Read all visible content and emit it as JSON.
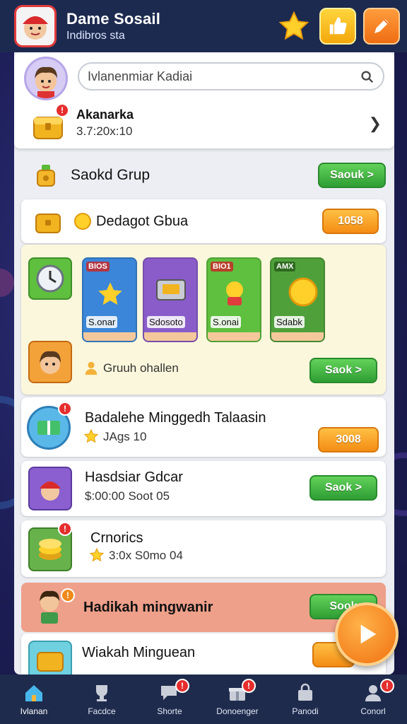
{
  "header": {
    "title": "Dame Sosail",
    "subtitle": "Indibros sta"
  },
  "profile": {
    "search_placeholder": "Ivlanenmiar Kadiai",
    "item_name": "Akanarka",
    "item_meta": "3.7:20x:10",
    "badge": "!"
  },
  "section": {
    "title": "Saokd Grup",
    "button_label": "Saouk >"
  },
  "daily_row": {
    "title": "Dedagot Gbua",
    "button_label": "1058"
  },
  "event": {
    "cards": [
      {
        "tag": "BIOS",
        "label": "S.onar",
        "color": "#3b86d8"
      },
      {
        "tag": "",
        "label": "Sdosoto",
        "color": "#8a5cc9"
      },
      {
        "tag": "BIO1",
        "label": "S.onai",
        "color": "#5fbf3e"
      },
      {
        "tag": "AMX",
        "label": "Sdabk",
        "color": "#4fa03a"
      }
    ],
    "footer_text": "Gruuh ohallen",
    "button_label": "Saok >"
  },
  "rows": [
    {
      "title": "Badalehe Minggedh Talaasin",
      "sub": "JAgs 10",
      "button_label": "3008",
      "button_type": "orange"
    },
    {
      "title": "Hasdsiar Gdcar",
      "sub": "$:00:00 Soot 05",
      "button_label": "Saok >",
      "button_type": "green"
    },
    {
      "title": "Crnorics",
      "sub": "3:0x S0mo 04",
      "button_label": "",
      "button_type": ""
    }
  ],
  "highlight": {
    "title": "Hadikah mingwanir",
    "button_label": "Sook"
  },
  "bottom_row": {
    "title": "Wiakah Minguean"
  },
  "nav": [
    {
      "label": "Ivlanan",
      "icon": "home-icon",
      "active": true
    },
    {
      "label": "Facdce",
      "icon": "trophy-icon",
      "active": false
    },
    {
      "label": "Shorte",
      "icon": "chat-icon",
      "active": false
    },
    {
      "label": "Donoenger",
      "icon": "gift-icon",
      "active": false
    },
    {
      "label": "Panodi",
      "icon": "shop-icon",
      "active": false
    },
    {
      "label": "Conorl",
      "icon": "profile-icon",
      "active": false
    }
  ],
  "colors": {
    "background": "#1c1d55",
    "header": "#1d2a4f",
    "green_button": "#3fae3f",
    "orange_button": "#f59a1c",
    "highlight": "#eea08a"
  }
}
